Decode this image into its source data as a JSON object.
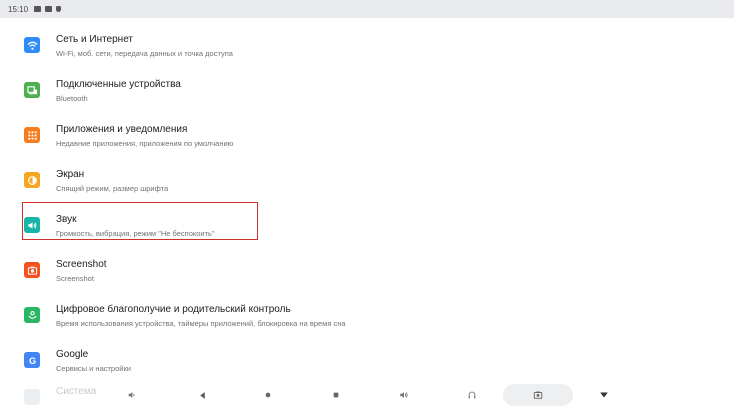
{
  "status_bar": {
    "time": "15:10"
  },
  "colors": {
    "network": "#2f8df5",
    "devices": "#4caf50",
    "apps": "#f57c1f",
    "display": "#f5a623",
    "sound": "#16b5a8",
    "screenshot": "#f4511e",
    "wellbeing": "#29b765",
    "google": "#4285f4",
    "highlight": "#d0302a"
  },
  "settings": {
    "items": [
      {
        "title": "Сеть и Интернет",
        "subtitle": "Wi-Fi, моб. сети, передача данных и точка доступа",
        "icon": "wifi-icon"
      },
      {
        "title": "Подключенные устройства",
        "subtitle": "Bluetooth",
        "icon": "devices-icon"
      },
      {
        "title": "Приложения и уведомления",
        "subtitle": "Недавние приложения, приложения по умолчанию",
        "icon": "apps-grid-icon"
      },
      {
        "title": "Экран",
        "subtitle": "Спящий режим, размер шрифта",
        "icon": "brightness-icon"
      },
      {
        "title": "Звук",
        "subtitle": "Громкость, вибрация, режим \"Не беспокоить\"",
        "icon": "volume-icon"
      },
      {
        "title": "Screenshot",
        "subtitle": "Screenshot",
        "icon": "camera-icon"
      },
      {
        "title": "Цифровое благополучие и родительский контроль",
        "subtitle": "Время использования устройства, таймеры приложений, блокировка на время сна",
        "icon": "wellbeing-icon"
      },
      {
        "title": "Google",
        "subtitle": "Сервисы и настройки",
        "icon": "google-icon"
      },
      {
        "title": "Система",
        "subtitle": "",
        "icon": "system-icon"
      }
    ]
  },
  "navbar": {
    "buttons": [
      "volume-down-icon",
      "back-icon",
      "home-icon",
      "recents-icon",
      "volume-up-icon",
      "headset-icon",
      "screenshot-icon",
      "dropdown-icon"
    ]
  }
}
